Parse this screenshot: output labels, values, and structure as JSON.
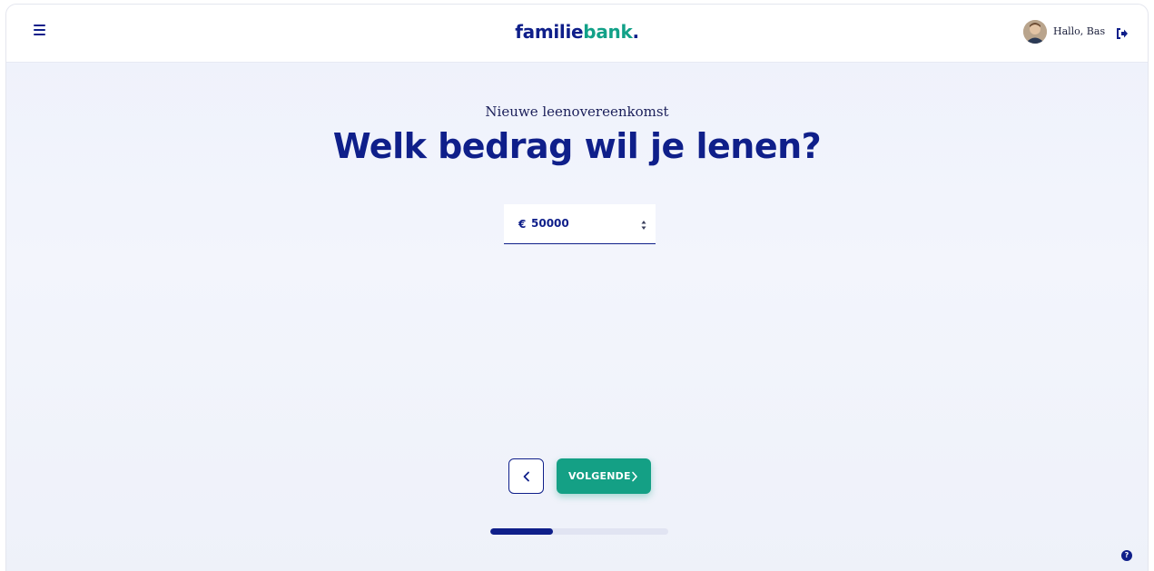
{
  "header": {
    "logo_part1": "familie",
    "logo_part2": "bank",
    "logo_dot": ".",
    "greeting": "Hallo, Bas",
    "menu_icon": "hamburger-icon",
    "logout_icon": "logout-icon"
  },
  "main": {
    "subtitle": "Nieuwe leenovereenkomst",
    "title": "Welk bedrag wil je lenen?",
    "amount": {
      "currency_symbol": "€",
      "value": "50000"
    }
  },
  "nav": {
    "back_icon": "chevron-left-icon",
    "next_label": "VOLGENDE",
    "next_icon": "chevron-right-icon"
  },
  "progress": {
    "fraction": 0.35
  },
  "help": {
    "symbol": "?"
  },
  "colors": {
    "primary": "#0f1f8a",
    "accent": "#14a085",
    "background": "#eef1fb"
  }
}
